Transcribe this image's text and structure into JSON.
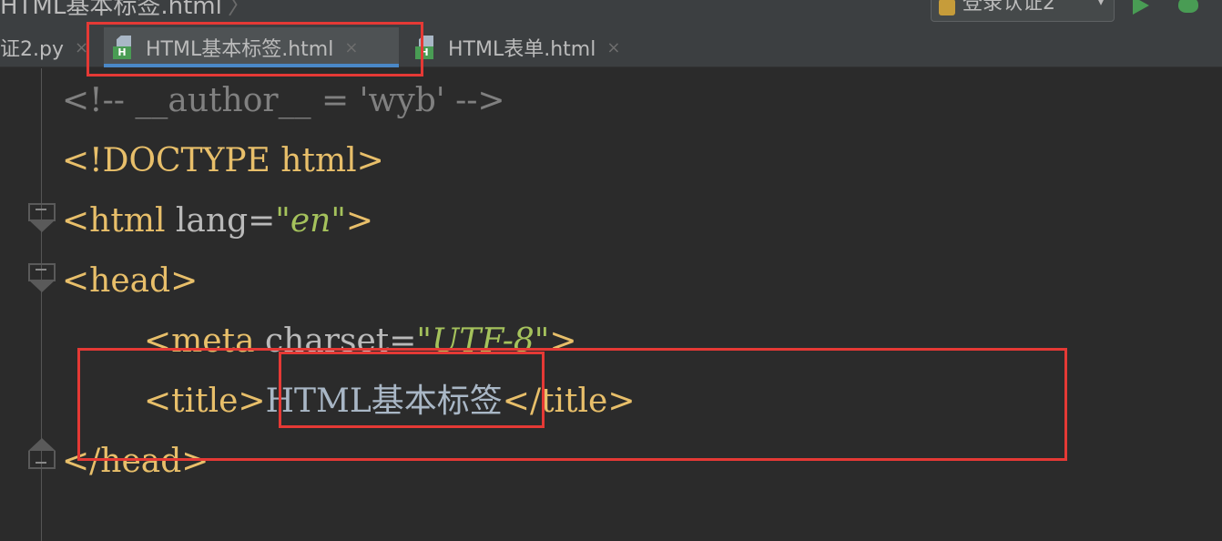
{
  "breadcrumb": {
    "file": "HTML基本标签.html",
    "separator": "〉"
  },
  "toolbar": {
    "run_config_label": "登录认证2",
    "run_config_arrow": "▾",
    "run_icon": "run-icon",
    "debug_icon": "debug-icon"
  },
  "tabs": [
    {
      "label": "证2.py",
      "close": "×",
      "active": false
    },
    {
      "label": "HTML基本标签.html",
      "close": "×",
      "active": true,
      "icon": "html-file-icon"
    },
    {
      "label": "HTML表单.html",
      "close": "×",
      "active": false,
      "icon": "html-file-icon"
    }
  ],
  "editor": {
    "lines": [
      {
        "p1": "<!--",
        "p2": " __author__ = 'wyb' ",
        "p3": "-->"
      },
      {
        "p1": "<!DOCTYPE",
        "p2": " html",
        "p3": ">"
      },
      {
        "p1": "<html",
        "p2": " lang=",
        "p3": "\"en\"",
        "p4": ">"
      },
      {
        "p1": "<head>"
      },
      {
        "p1": "<meta",
        "p2": " charset=",
        "p3": "\"UTF-8\"",
        "p4": ">"
      },
      {
        "p1": "<title>",
        "p2": "HTML基本标签",
        "p3": "</title>"
      },
      {
        "p1": "</head>"
      }
    ]
  },
  "colors": {
    "background": "#2b2b2b",
    "tag": "#e8bf6a",
    "comment": "#808080",
    "string": "#a5c25c",
    "active_tab_underline": "#4a88c7",
    "annotation": "#e53935"
  }
}
